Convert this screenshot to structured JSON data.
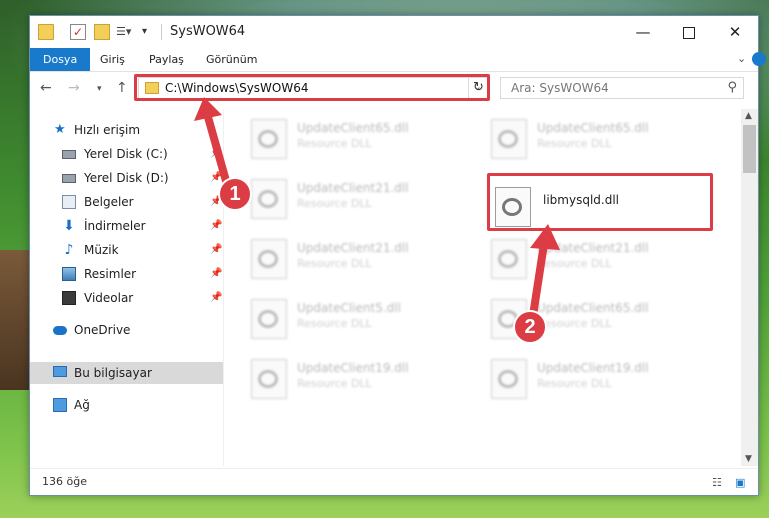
{
  "window": {
    "title": "SysWOW64",
    "minimize_glyph": "—",
    "close_glyph": "✕"
  },
  "ribbon": {
    "tabs": [
      "Dosya",
      "Giriş",
      "Paylaş",
      "Görünüm"
    ]
  },
  "navbar": {
    "address": "C:\\Windows\\SysWOW64",
    "search_placeholder": "Ara: SysWOW64"
  },
  "sidebar": {
    "items": [
      {
        "label": "Hızlı erişim",
        "icon": "star-icon",
        "pinned": false
      },
      {
        "label": "Yerel Disk (C:)",
        "icon": "drive-icon",
        "pinned": true
      },
      {
        "label": "Yerel Disk (D:)",
        "icon": "drive-icon",
        "pinned": true
      },
      {
        "label": "Belgeler",
        "icon": "documents-icon",
        "pinned": true
      },
      {
        "label": "İndirmeler",
        "icon": "downloads-icon",
        "pinned": true
      },
      {
        "label": "Müzik",
        "icon": "music-icon",
        "pinned": true
      },
      {
        "label": "Resimler",
        "icon": "pictures-icon",
        "pinned": true
      },
      {
        "label": "Videolar",
        "icon": "videos-icon",
        "pinned": true
      },
      {
        "label": "OneDrive",
        "icon": "onedrive-icon",
        "pinned": false
      },
      {
        "label": "Bu bilgisayar",
        "icon": "this-pc-icon",
        "pinned": false,
        "selected": true
      },
      {
        "label": "Ağ",
        "icon": "network-icon",
        "pinned": false
      }
    ]
  },
  "files": [
    {
      "name": "UpdateClient65.dll",
      "type": "Resource DLL"
    },
    {
      "name": "UpdateClient65.dll",
      "type": "Resource DLL"
    },
    {
      "name": "UpdateClient21.dll",
      "type": "Resource DLL"
    },
    {
      "name": "libmysqld.dll",
      "type": "",
      "highlighted": true
    },
    {
      "name": "UpdateClient21.dll",
      "type": "Resource DLL"
    },
    {
      "name": "UpdateClient21.dll",
      "type": "Resource DLL"
    },
    {
      "name": "UpdateClient5.dll",
      "type": "Resource DLL"
    },
    {
      "name": "UpdateClient65.dll",
      "type": "Resource DLL"
    },
    {
      "name": "UpdateClient19.dll",
      "type": "Resource DLL"
    },
    {
      "name": "UpdateClient19.dll",
      "type": "Resource DLL"
    }
  ],
  "status": {
    "item_count": "136 öğe"
  },
  "annotations": {
    "step1": "1",
    "step2": "2",
    "color": "#dc3c43"
  }
}
